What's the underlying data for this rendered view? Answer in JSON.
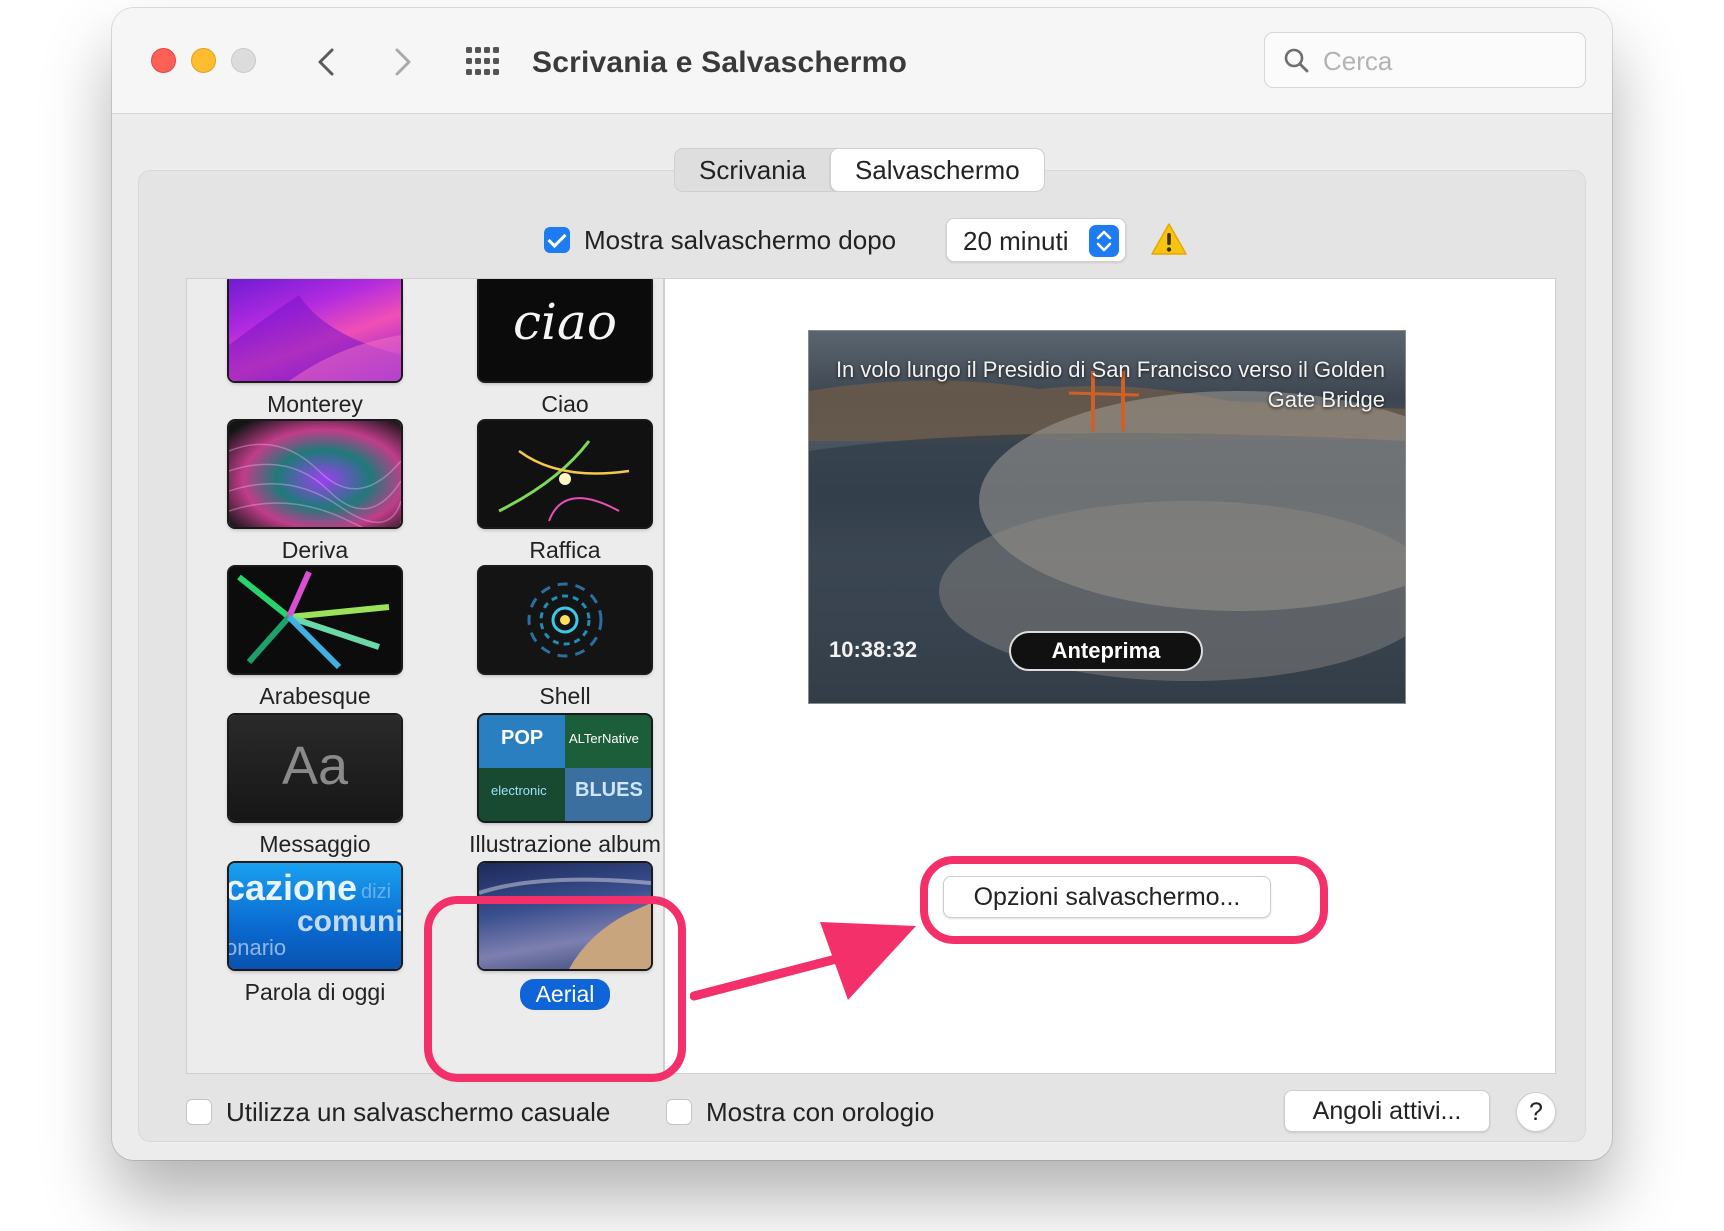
{
  "window": {
    "title": "Scrivania e Salvaschermo",
    "search_placeholder": "Cerca"
  },
  "tabs": [
    {
      "label": "Scrivania",
      "active": false
    },
    {
      "label": "Salvaschermo",
      "active": true
    }
  ],
  "show_after": {
    "label": "Mostra salvaschermo dopo",
    "checked": true,
    "value": "20 minuti"
  },
  "savers": [
    {
      "label": "Monterey"
    },
    {
      "label": "Ciao"
    },
    {
      "label": "Deriva"
    },
    {
      "label": "Raffica"
    },
    {
      "label": "Arabesque"
    },
    {
      "label": "Shell"
    },
    {
      "label": "Messaggio"
    },
    {
      "label": "Illustrazione album"
    },
    {
      "label": "Parola di oggi"
    },
    {
      "label": "Aerial",
      "selected": true
    }
  ],
  "thumb_text": {
    "ciao": "ciao",
    "messaggio": "Aa",
    "parola_lines": [
      "cazione",
      "dizi",
      "comuni",
      "onario"
    ],
    "album_tiles": [
      "POP",
      "ALTerNative",
      "electr",
      "electronic",
      "BLUES"
    ]
  },
  "preview": {
    "caption": "In volo lungo il Presidio di San Francisco verso il Golden Gate Bridge",
    "time": "10:38:32",
    "button": "Anteprima"
  },
  "options_button": "Opzioni salvaschermo...",
  "random_checkbox": {
    "label": "Utilizza un salvaschermo casuale",
    "checked": false
  },
  "clock_checkbox": {
    "label": "Mostra con orologio",
    "checked": false
  },
  "hot_corners_button": "Angoli attivi...",
  "help_button": "?",
  "colors": {
    "accent": "#1e7cf2",
    "annotation": "#f4306b"
  }
}
